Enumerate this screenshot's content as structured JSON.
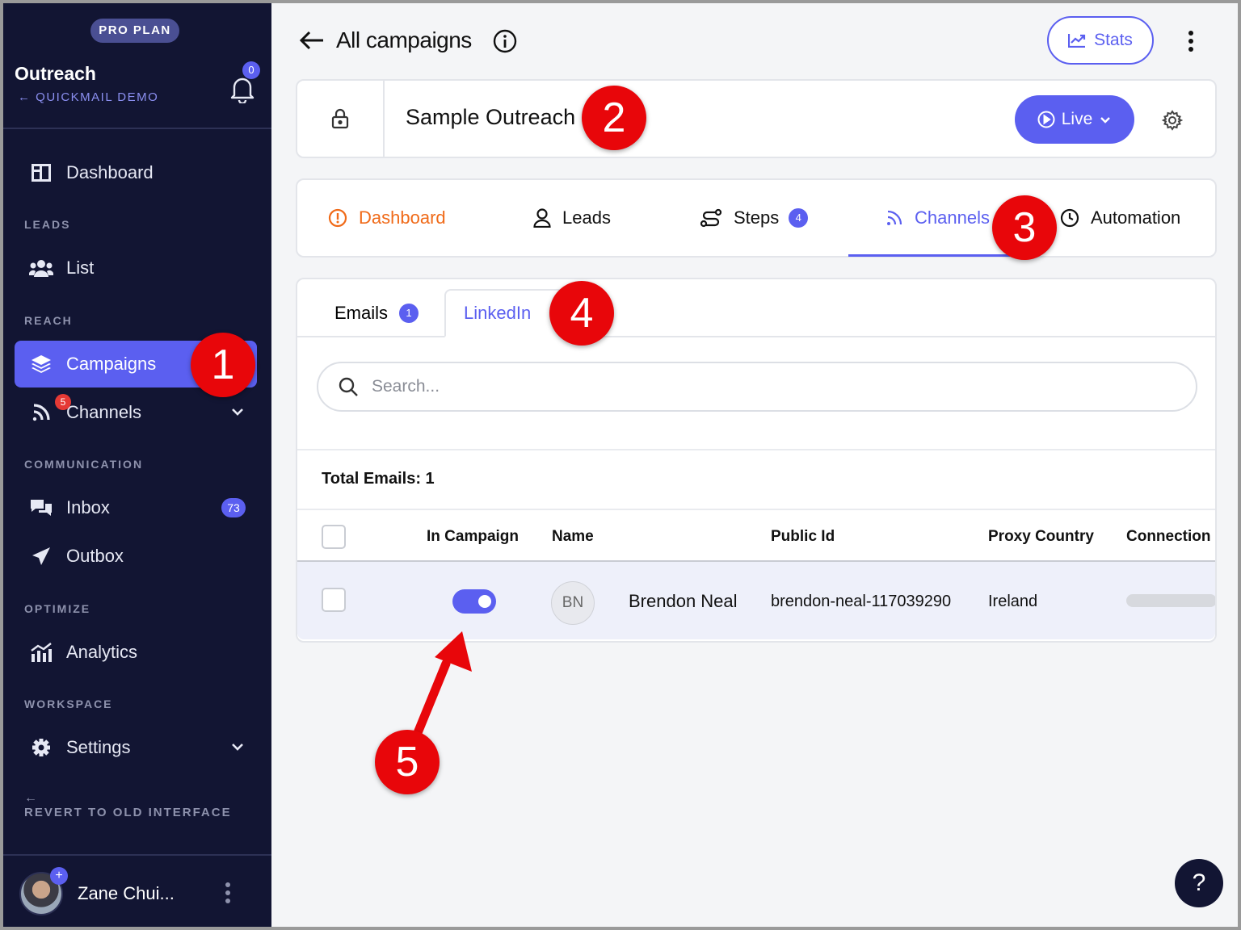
{
  "sidebar": {
    "plan_badge": "PRO PLAN",
    "org_name": "Outreach",
    "org_sub": "QUICKMAIL DEMO",
    "notification_count": "0",
    "sections": {
      "leads": "LEADS",
      "reach": "REACH",
      "communication": "COMMUNICATION",
      "optimize": "OPTIMIZE",
      "workspace": "WORKSPACE"
    },
    "items": {
      "dashboard": "Dashboard",
      "list": "List",
      "campaigns": "Campaigns",
      "channels": "Channels",
      "channels_badge": "5",
      "inbox": "Inbox",
      "inbox_count": "73",
      "outbox": "Outbox",
      "analytics": "Analytics",
      "settings": "Settings"
    },
    "revert": "REVERT TO OLD INTERFACE",
    "user_name": "Zane Chui..."
  },
  "header": {
    "title": "All campaigns",
    "stats_label": "Stats"
  },
  "campaign": {
    "name": "Sample Outreach",
    "status_label": "Live"
  },
  "tabs": {
    "dashboard": "Dashboard",
    "leads": "Leads",
    "steps": "Steps",
    "steps_count": "4",
    "channels": "Channels",
    "automation": "Automation"
  },
  "channels_panel": {
    "subtabs": {
      "emails": "Emails",
      "emails_count": "1",
      "linkedin": "LinkedIn"
    },
    "search_placeholder": "Search...",
    "total_label": "Total Emails: 1",
    "columns": [
      "In Campaign",
      "Name",
      "Public Id",
      "Proxy Country",
      "Connection"
    ],
    "rows": [
      {
        "in_campaign": true,
        "initials": "BN",
        "name": "Brendon Neal",
        "public_id": "brendon-neal-117039290",
        "proxy_country": "Ireland"
      }
    ]
  },
  "callouts": [
    "1",
    "2",
    "3",
    "4",
    "5"
  ],
  "help_label": "?",
  "colors": {
    "sidebar_bg": "#121533",
    "accent": "#5b5ff0",
    "dashboard_tab": "#f06a18",
    "callout": "#e8060a"
  }
}
